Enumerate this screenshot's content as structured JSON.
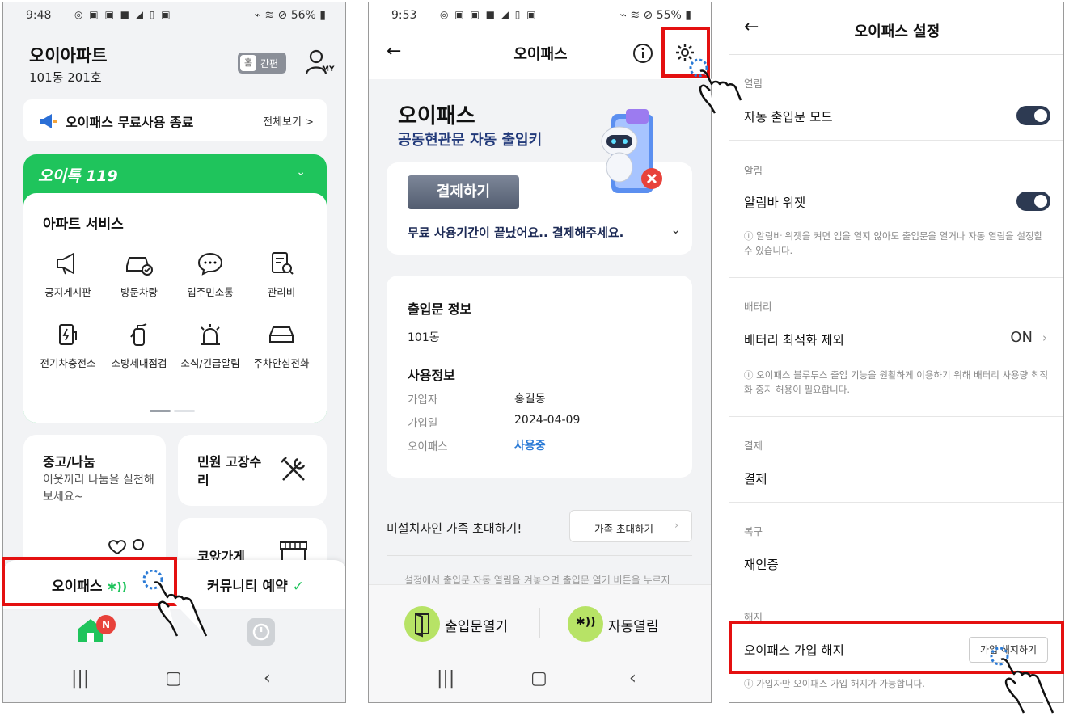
{
  "phone1": {
    "status": {
      "time": "9:48",
      "battery": "56%"
    },
    "title": "오이아파트",
    "unit": "101동 201호",
    "mode_toggle": {
      "home": "홈",
      "simple": "간편"
    },
    "my_label": "MY",
    "notice": {
      "text": "오이패스 무료사용 종료",
      "more": "전체보기 >"
    },
    "brand": "오이톡 119",
    "services_title": "아파트 서비스",
    "services": [
      "공지게시판",
      "방문차량",
      "입주민소통",
      "관리비",
      "전기차충전소",
      "소방세대점검",
      "소식/긴급알림",
      "주차안심전화"
    ],
    "used_card": {
      "title": "중고/나눔",
      "desc": "이웃끼리 나눔을 실천해 보세요~"
    },
    "repair_card": {
      "title": "민원 고장수리"
    },
    "shop_card": {
      "title": "코앞가게"
    },
    "tabs": {
      "opass": "오이패스",
      "community": "커뮤니티 예약"
    },
    "badge": "N"
  },
  "phone2": {
    "status": {
      "time": "9:53",
      "battery": "55%"
    },
    "header_title": "오이패스",
    "hero_title": "오이패스",
    "hero_sub": "공동현관문 자동 출입키",
    "pay_button": "결제하기",
    "pay_message": "무료 사용기간이 끝났어요.. 결제해주세요.",
    "door_info_title": "출입문 정보",
    "door_info_value": "101동",
    "usage_title": "사용정보",
    "usage": [
      {
        "key": "가입자",
        "value": "홍길동"
      },
      {
        "key": "가입일",
        "value": "2024-04-09"
      },
      {
        "key": "오이패스",
        "value": "사용중"
      }
    ],
    "invite_text": "미설치자인 가족 초대하기!",
    "invite_button": "가족 초대하기",
    "cut_text": "설정에서 출입문 자동 열림을 켜놓으면 출입문 열기 버튼을 누르지",
    "action_open": "출입문열기",
    "action_auto": "자동열림"
  },
  "phone3": {
    "header_title": "오이패스 설정",
    "sections": {
      "open_label": "열림",
      "auto_door": "자동 출입문 모드",
      "notify_label": "알림",
      "widget": "알림바 위젯",
      "widget_desc": "알림바 위젯을 켜면 앱을 열지 않아도 출입문을 열거나 자동 열림을 설정할 수 있습니다.",
      "battery_label": "배터리",
      "battery_opt": "배터리 최적화 제외",
      "battery_value": "ON",
      "battery_desc": "오이패스 블루투스 출입 기능을 원활하게 이용하기 위해 배터리 사용량 최적화 중지 허용이 필요합니다.",
      "payment_label": "결제",
      "payment": "결제",
      "recover_label": "복구",
      "reauth": "재인증",
      "cancel_label": "해지",
      "cancel_row": "오이패스 가입 해지",
      "cancel_button": "가입 해지하기",
      "cancel_desc": "가입자만 오이패스 가입 해지가 가능합니다."
    }
  },
  "colors": {
    "green": "#1fc45c",
    "highlight": "#e41010",
    "navy": "#2d3a52",
    "lime": "#b7e366"
  }
}
